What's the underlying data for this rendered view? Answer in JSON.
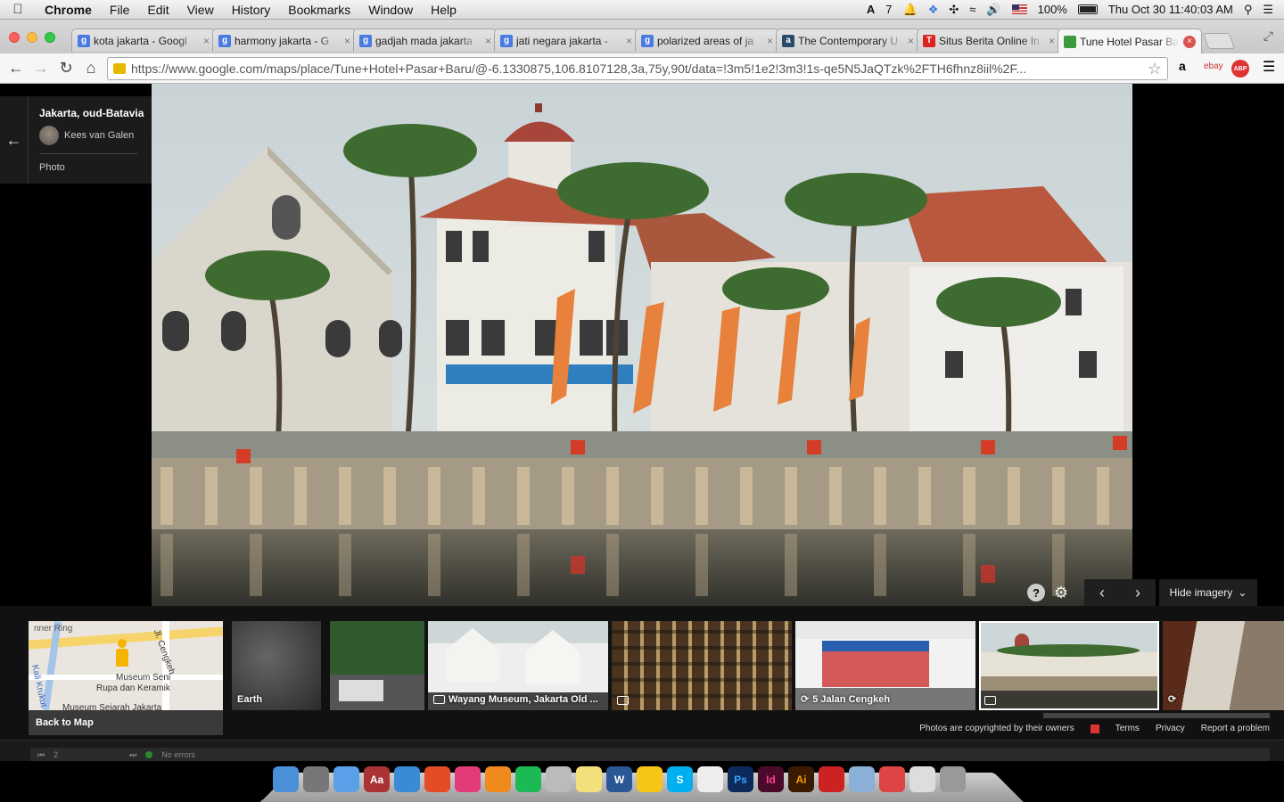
{
  "menubar": {
    "app": "Chrome",
    "menus": [
      "File",
      "Edit",
      "View",
      "History",
      "Bookmarks",
      "Window",
      "Help"
    ],
    "adobe_count": "7",
    "battery": "100%",
    "clock": "Thu Oct 30  11:40:03 AM"
  },
  "tabs": [
    {
      "label": "kota jakarta - Googl",
      "favicon": "g",
      "color": "#4a7be0"
    },
    {
      "label": "harmony jakarta - G",
      "favicon": "g",
      "color": "#4a7be0"
    },
    {
      "label": "gadjah mada jakarta",
      "favicon": "g",
      "color": "#4a7be0"
    },
    {
      "label": "jati negara jakarta -",
      "favicon": "g",
      "color": "#4a7be0"
    },
    {
      "label": "polarized areas of ja",
      "favicon": "g",
      "color": "#4a7be0"
    },
    {
      "label": "The Contemporary U",
      "favicon": "a",
      "color": "#2a4a6a"
    },
    {
      "label": "Situs Berita Online In",
      "favicon": "T",
      "color": "#d22"
    },
    {
      "label": "Tune Hotel Pasar Bar",
      "favicon": "map",
      "color": "#3c9a3c",
      "active": true
    }
  ],
  "address": {
    "url": "https://www.google.com/maps/place/Tune+Hotel+Pasar+Baru/@-6.1330875,106.8107128,3a,75y,90t/data=!3m5!1e2!3m3!1s-qe5N5JaQTzk%2FTH6fhnz8iil%2F..."
  },
  "extensions": [
    "a",
    "ebay",
    "ABP"
  ],
  "photo_info": {
    "title": "Jakarta, oud-Batavia",
    "author": "Kees van Galen",
    "type": "Photo"
  },
  "viewer": {
    "hide_imagery": "Hide imagery"
  },
  "filmstrip": {
    "back_to_map": "Back to Map",
    "map_labels": [
      "Museum Seni",
      "Rupa dan Keramik",
      "Museum Sejarah Jakarta",
      "Kali Krukut",
      "Jl. Cengkeh",
      "nner Ring"
    ],
    "thumbs": [
      {
        "caption": "Earth",
        "icon": ""
      },
      {
        "caption": "",
        "icon": ""
      },
      {
        "caption": "Wayang Museum, Jakarta Old ...",
        "icon": "camera"
      },
      {
        "caption": "",
        "icon": "slideshow"
      },
      {
        "caption": "5 Jalan Cengkeh",
        "icon": "street-view"
      },
      {
        "caption": "",
        "icon": "camera"
      },
      {
        "caption": "",
        "icon": "street-view"
      }
    ],
    "footer": {
      "copyright": "Photos are copyrighted by their owners",
      "terms": "Terms",
      "privacy": "Privacy",
      "report": "Report a problem"
    }
  },
  "statusbar": {
    "page": "2",
    "errors": "No errors"
  }
}
